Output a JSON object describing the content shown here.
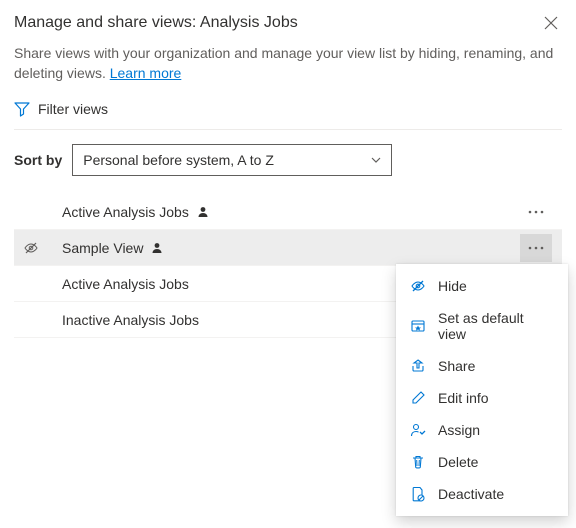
{
  "header": {
    "title": "Manage and share views: Analysis Jobs",
    "subtitle_a": "Share views with your organization and manage your view list by hiding, renaming, and deleting views. ",
    "learn_more": "Learn more"
  },
  "filter": {
    "label": "Filter views"
  },
  "sort": {
    "label": "Sort by",
    "selected": "Personal before system, A to Z"
  },
  "views": [
    {
      "name": "Active Analysis Jobs",
      "personal": true,
      "hidden": false,
      "selected": false,
      "showMore": true
    },
    {
      "name": "Sample View",
      "personal": true,
      "hidden": true,
      "selected": true,
      "showMore": true
    },
    {
      "name": "Active Analysis Jobs",
      "personal": false,
      "hidden": false,
      "selected": false,
      "showMore": false
    },
    {
      "name": "Inactive Analysis Jobs",
      "personal": false,
      "hidden": false,
      "selected": false,
      "showMore": false
    }
  ],
  "menu": {
    "hide": "Hide",
    "set_default": "Set as default view",
    "share": "Share",
    "edit_info": "Edit info",
    "assign": "Assign",
    "delete": "Delete",
    "deactivate": "Deactivate"
  }
}
